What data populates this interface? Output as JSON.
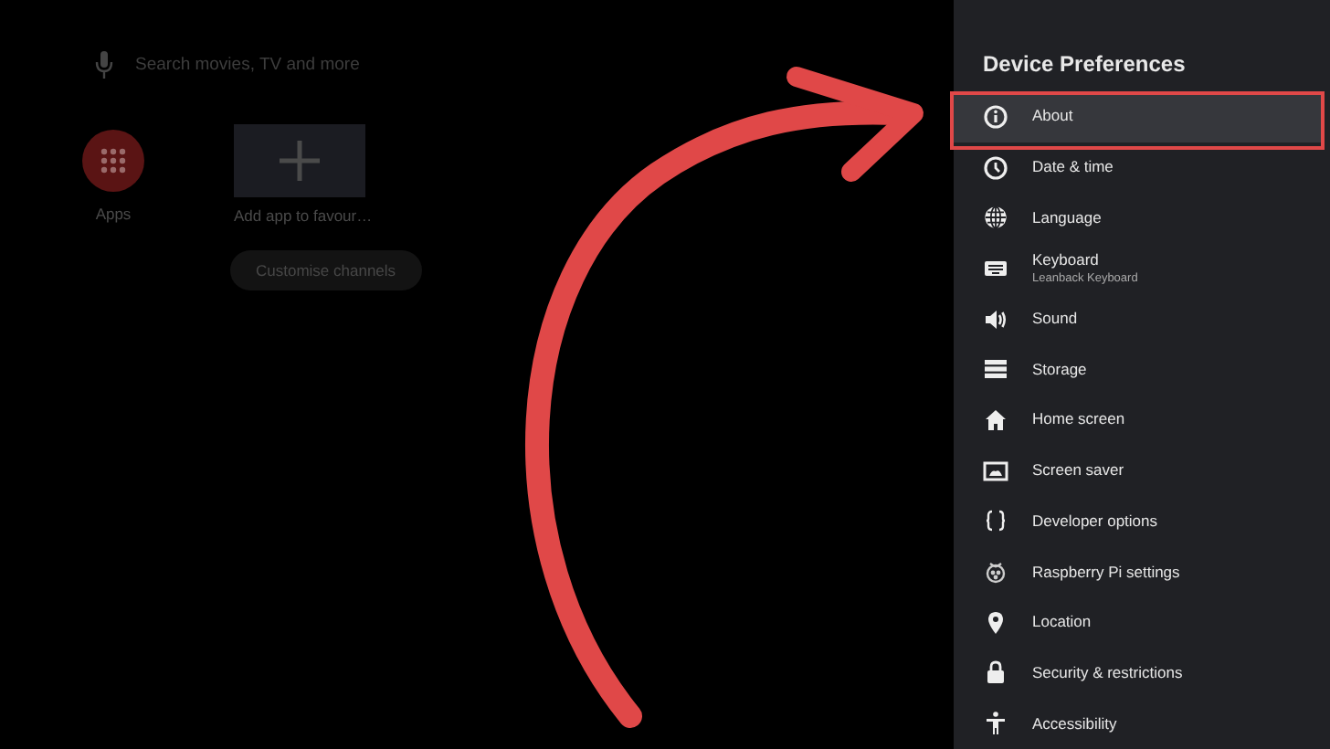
{
  "home": {
    "search": {
      "placeholder": "Search movies, TV and more"
    },
    "apps": [
      {
        "label": "Apps",
        "kind": "apps"
      },
      {
        "label": "Add app to favour…",
        "kind": "add"
      }
    ],
    "customise_button": "Customise channels"
  },
  "panel": {
    "title": "Device Preferences",
    "items": [
      {
        "label": "About",
        "selected": true
      },
      {
        "label": "Date & time",
        "selected": false
      },
      {
        "label": "Language",
        "selected": false
      },
      {
        "label": "Keyboard",
        "subtitle": "Leanback Keyboard",
        "selected": false
      },
      {
        "label": "Sound",
        "selected": false
      },
      {
        "label": "Storage",
        "selected": false
      },
      {
        "label": "Home screen",
        "selected": false
      },
      {
        "label": "Screen saver",
        "selected": false
      },
      {
        "label": "Developer options",
        "selected": false
      },
      {
        "label": "Raspberry Pi settings",
        "selected": false
      },
      {
        "label": "Location",
        "selected": false
      },
      {
        "label": "Security & restrictions",
        "selected": false
      },
      {
        "label": "Accessibility",
        "selected": false
      }
    ]
  }
}
